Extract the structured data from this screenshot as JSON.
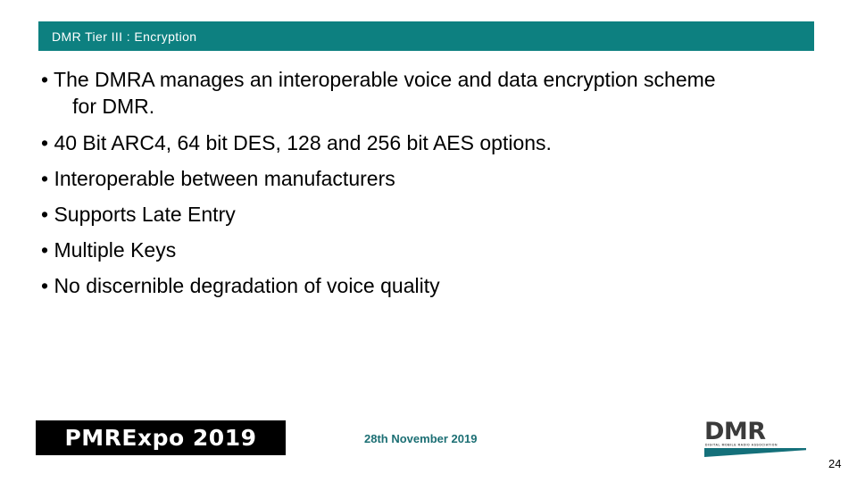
{
  "slide": {
    "title": "DMR Tier III : Encryption",
    "title_bar_color": "#0d8080",
    "background_color": "#ffffff",
    "bullets": [
      "• The DMRA manages an interoperable voice and data encryption scheme\n   for DMR.",
      "• 40 Bit ARC4, 64 bit DES, 128 and 256 bit AES options.",
      "• Interoperable between manufacturers",
      "• Supports Late Entry",
      "• Multiple Keys",
      "• No discernible degradation of voice quality"
    ]
  },
  "footer": {
    "event_logo": "PMRExpo 2019",
    "date": "28th November 2019",
    "date_color": "#1c6f74",
    "page_number": "24",
    "dmr_logo": {
      "wordmark": "DMR",
      "subtitle": "DIGITAL MOBILE RADIO ASSOCIATION",
      "wordmark_color": "#3b3b3b",
      "swoosh_color": "#14707a"
    }
  }
}
